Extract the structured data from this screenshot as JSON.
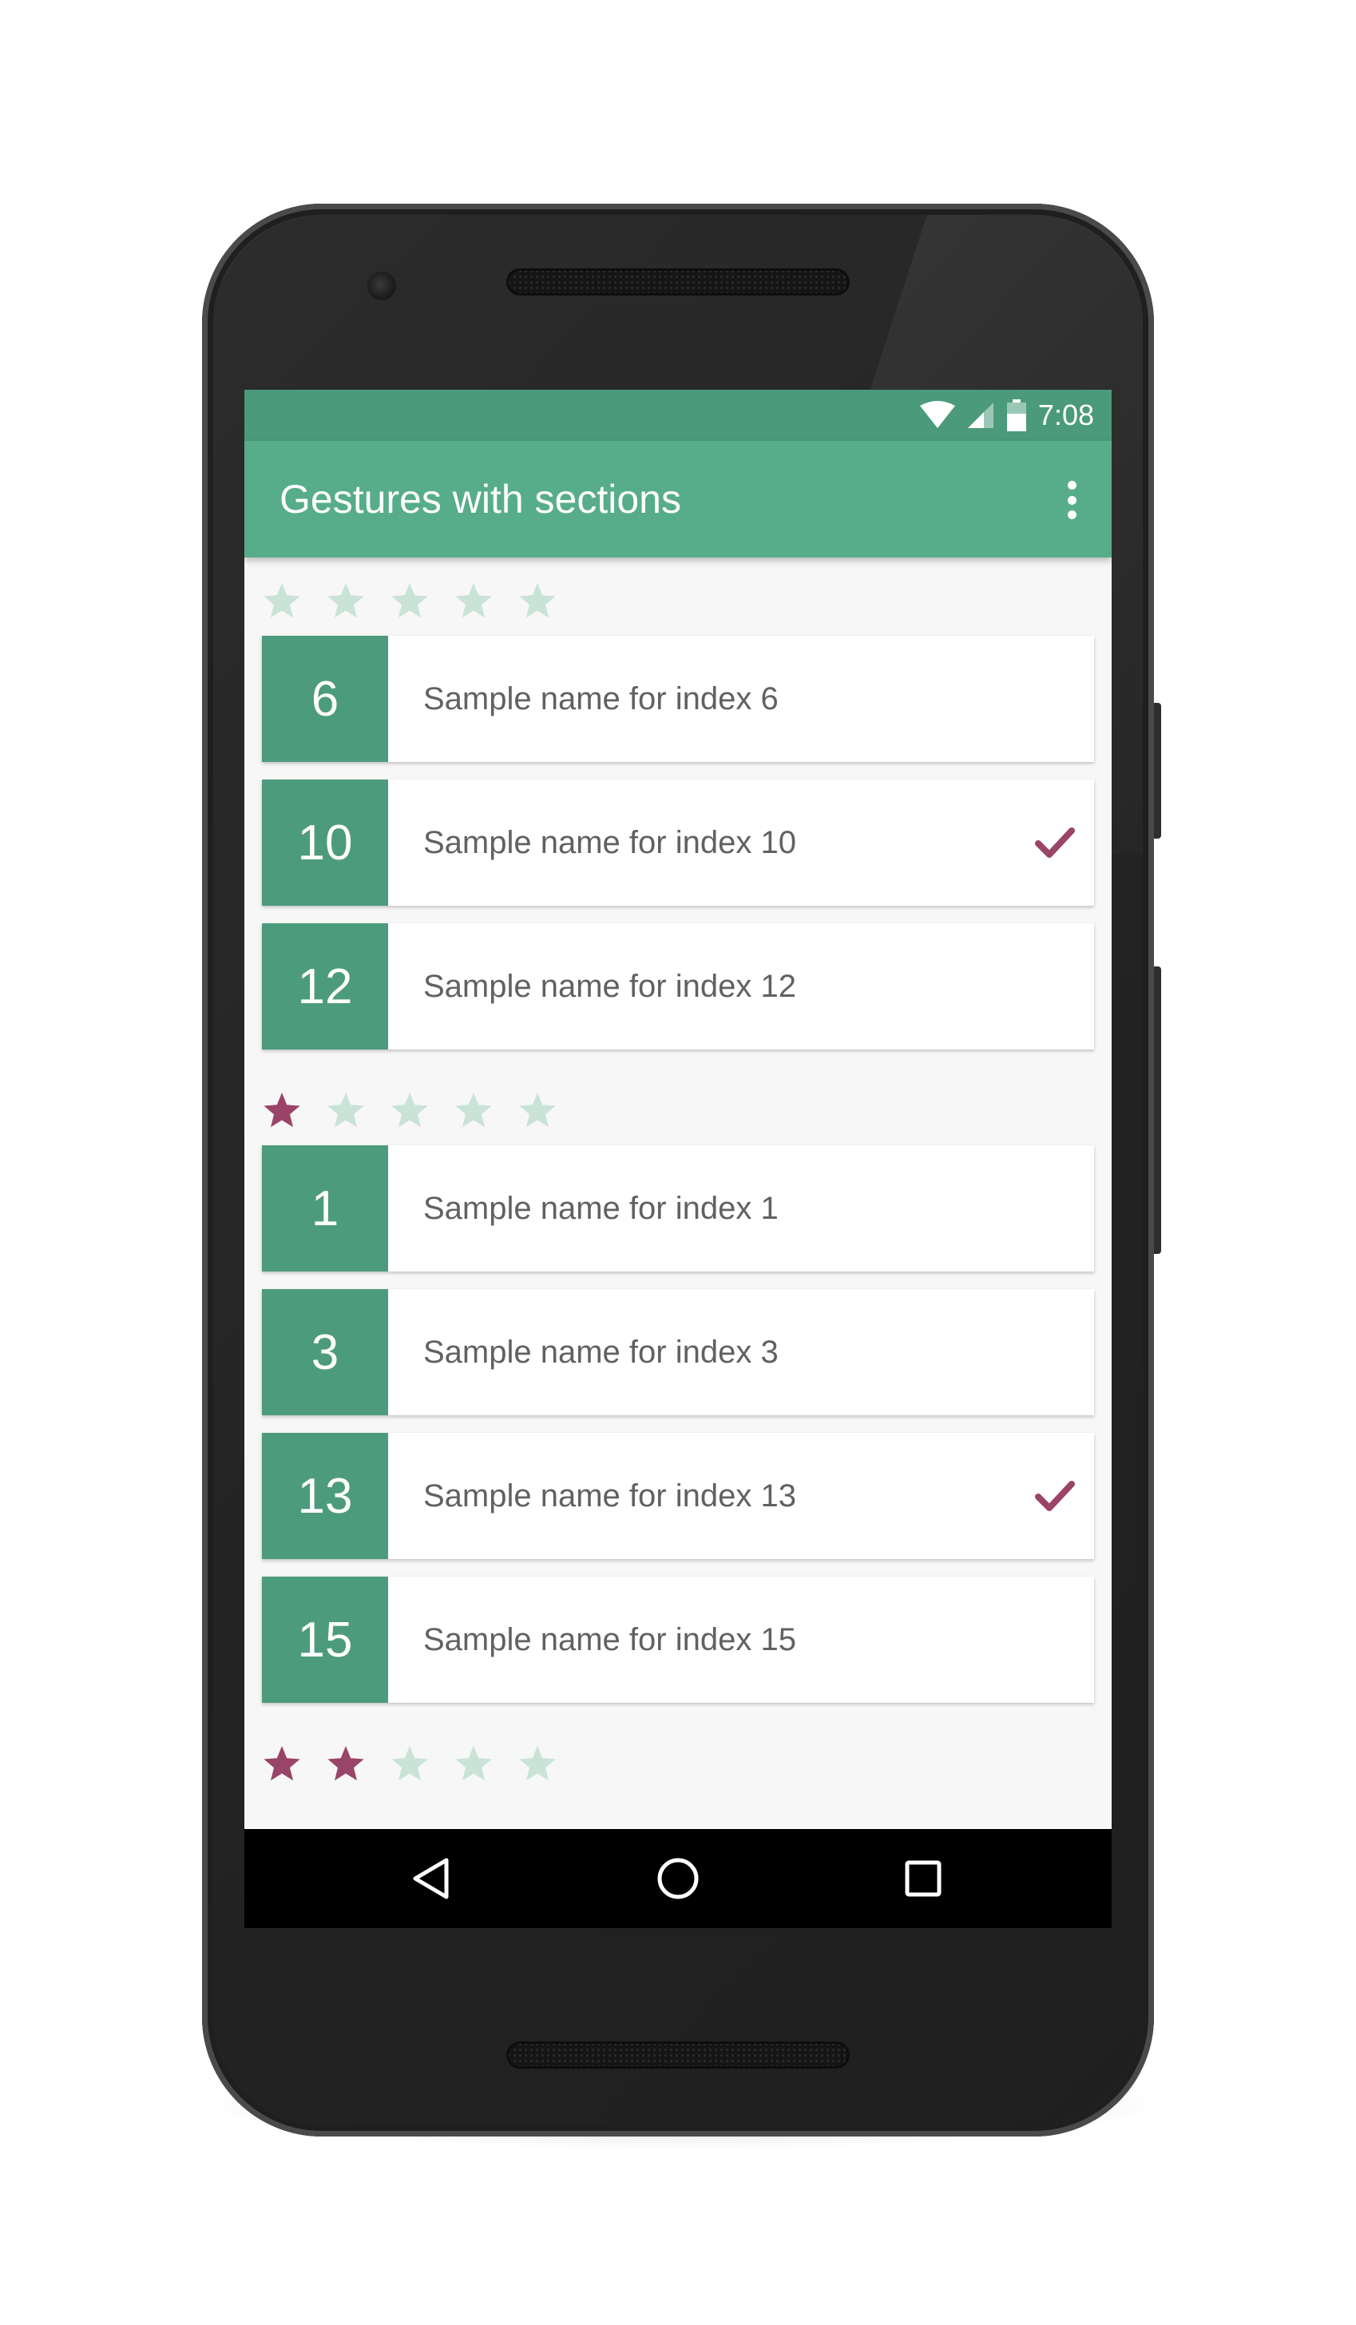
{
  "status_bar": {
    "time": "7:08"
  },
  "app_bar": {
    "title": "Gestures with sections"
  },
  "colors": {
    "primary": "#57ad89",
    "primary_dark": "#4a9a7b",
    "index_box": "#4d9b7d",
    "accent": "#9a4468",
    "star_empty": "#c9e3d7"
  },
  "sections": [
    {
      "stars_filled": 0,
      "stars_total": 5,
      "items": [
        {
          "index": "6",
          "name": "Sample name for index 6",
          "checked": false
        },
        {
          "index": "10",
          "name": "Sample name for index 10",
          "checked": true
        },
        {
          "index": "12",
          "name": "Sample name for index 12",
          "checked": false
        }
      ]
    },
    {
      "stars_filled": 1,
      "stars_total": 5,
      "items": [
        {
          "index": "1",
          "name": "Sample name for index 1",
          "checked": false
        },
        {
          "index": "3",
          "name": "Sample name for index 3",
          "checked": false
        },
        {
          "index": "13",
          "name": "Sample name for index 13",
          "checked": true
        },
        {
          "index": "15",
          "name": "Sample name for index 15",
          "checked": false
        }
      ]
    },
    {
      "stars_filled": 2,
      "stars_total": 5,
      "items": []
    }
  ],
  "icons": {
    "status": [
      "wifi-icon",
      "cellular-signal-icon",
      "battery-icon"
    ],
    "app_bar": [
      "more-vertical-icon"
    ],
    "item": [
      "check-icon"
    ],
    "section": [
      "star-icon"
    ],
    "navigation": [
      "back-icon",
      "home-icon",
      "recents-icon"
    ]
  }
}
